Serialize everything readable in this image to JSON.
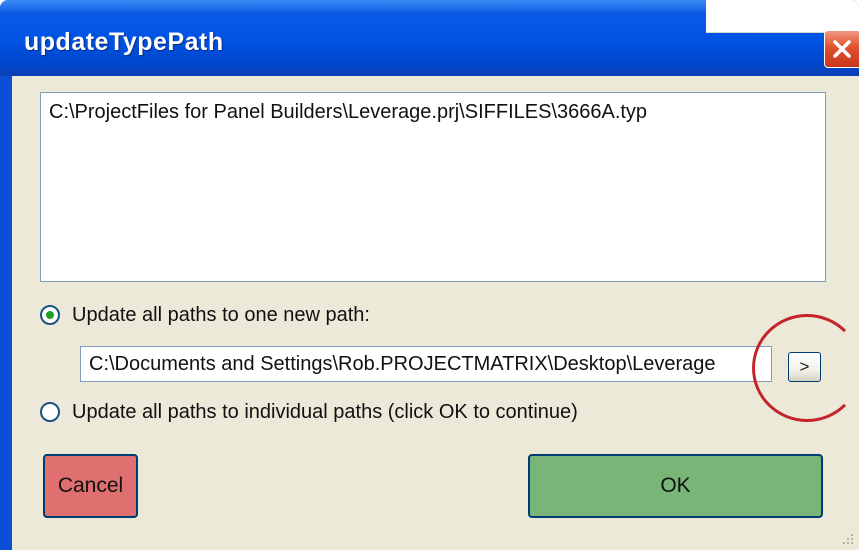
{
  "window": {
    "title": "updateTypePath",
    "close_glyph": "✕",
    "icons": {
      "close": "close-icon",
      "grip": "resize-grip-icon"
    }
  },
  "path_list": {
    "items": [
      "C:\\ProjectFiles for Panel Builders\\Leverage.prj\\SIFFILES\\3666A.typ"
    ]
  },
  "options": {
    "one_new_path_label": "Update all paths to one new path:",
    "one_new_path_selected": true,
    "new_path_value": "C:\\Documents and Settings\\Rob.PROJECTMATRIX\\Desktop\\Leverage",
    "browse_label": ">",
    "individual_paths_label": "Update all paths to individual paths (click OK to continue)",
    "individual_paths_selected": false
  },
  "buttons": {
    "cancel": "Cancel",
    "ok": "OK"
  },
  "colors": {
    "titlebar": "#0054e3",
    "dialog_bg": "#ece9d8",
    "cancel_bg": "#e07070",
    "ok_bg": "#78b577",
    "annotation": "#c4242a"
  }
}
